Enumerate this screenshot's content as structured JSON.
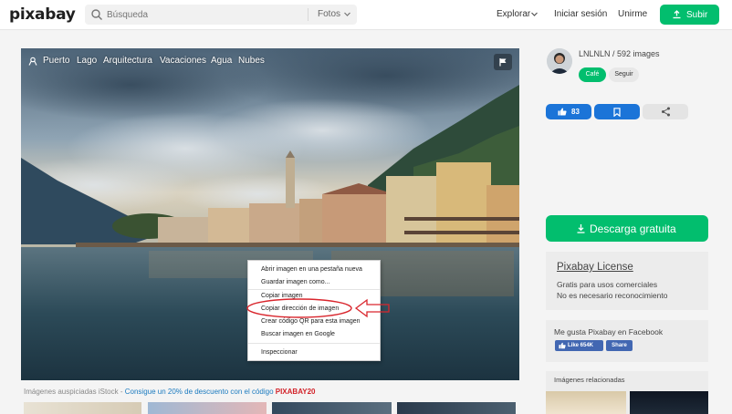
{
  "header": {
    "logo": "pixabay",
    "search_placeholder": "Búsqueda",
    "search_category": "Fotos",
    "nav_explore": "Explorar",
    "nav_login": "Iniciar sesión",
    "nav_join": "Unirme",
    "upload_label": "Subir"
  },
  "photo": {
    "tags": [
      "Puerto",
      "Lago",
      "Arquitectura",
      "Vacaciones",
      "Agua",
      "Nubes"
    ]
  },
  "context_menu": {
    "items": [
      "Abrir imagen en una pestaña nueva",
      "Guardar imagen como...",
      "Copiar imagen",
      "Copiar dirección de imagen",
      "Crear código QR para esta imagen",
      "Buscar imagen en Google",
      "Inspeccionar"
    ]
  },
  "sponsor": {
    "prefix": "Imágenes auspiciadas iStock - ",
    "link": "Consigue un 20% de descuento con el código ",
    "code": "PIXABAY20"
  },
  "sidebar": {
    "user": "LNLNLN / 592 images",
    "coffee_label": "Café",
    "follow_label": "Seguir",
    "likes": "83",
    "download_label": "Descarga gratuita",
    "license_title": "Pixabay License",
    "license_line1": "Gratis para usos comerciales",
    "license_line2": "No es necesario reconocimiento",
    "fb_title": "Me gusta Pixabay en Facebook",
    "fb_like": "Like 654K",
    "fb_share": "Share",
    "related_title": "Imágenes relacionadas"
  },
  "colors": {
    "green": "#02be6e",
    "blue": "#1b74d8",
    "facebook": "#4267b2",
    "promo_red": "#d2232a"
  }
}
